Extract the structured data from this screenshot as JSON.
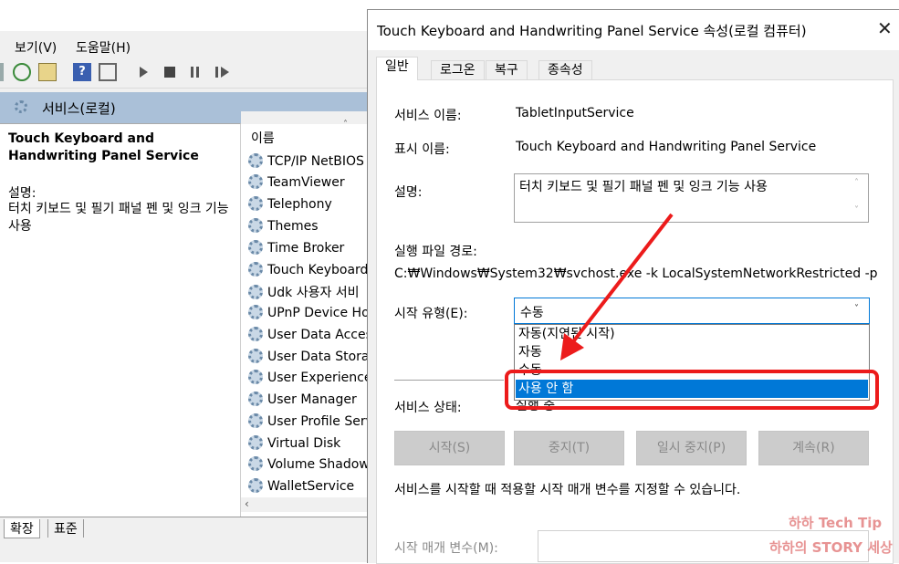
{
  "bg_window": {
    "menu": [
      "보기(V)",
      "도움말(H)"
    ],
    "panel_title": "서비스(로컬)",
    "selected_service_title": "Touch Keyboard and Handwriting Panel Service",
    "desc_label": "설명:",
    "desc_text": "터치 키보드 및 필기 패널 펜 및 잉크 기능 사용",
    "column_header": "이름",
    "services": [
      "TCP/IP NetBIOS",
      "TeamViewer",
      "Telephony",
      "Themes",
      "Time Broker",
      "Touch Keyboard",
      "Udk 사용자 서비",
      "UPnP Device Ho",
      "User Data Access",
      "User Data Storag",
      "User Experience",
      "User Manager",
      "User Profile Serv",
      "Virtual Disk",
      "Volume Shadow",
      "WalletService"
    ],
    "bottom_tabs": [
      "확장",
      "표준"
    ]
  },
  "dialog": {
    "title": "Touch Keyboard and Handwriting Panel Service 속성(로컬 컴퓨터)",
    "tabs": [
      "일반",
      "로그온",
      "복구",
      "종속성"
    ],
    "service_name_label": "서비스 이름:",
    "service_name": "TabletInputService",
    "display_name_label": "표시 이름:",
    "display_name": "Touch Keyboard and Handwriting Panel Service",
    "description_label": "설명:",
    "description": "터치 키보드 및 필기 패널 펜 및 잉크 기능 사용",
    "exe_path_label": "실행 파일 경로:",
    "exe_path": "C:₩Windows₩System32₩svchost.exe -k LocalSystemNetworkRestricted -p",
    "startup_type_label": "시작 유형(E):",
    "startup_type_value": "수동",
    "startup_options": [
      "자동(지연된 시작)",
      "자동",
      "수동",
      "사용 안 함"
    ],
    "service_status_label": "서비스 상태:",
    "service_status": "실행 중",
    "buttons": [
      "시작(S)",
      "중지(T)",
      "일시 중지(P)",
      "계속(R)"
    ],
    "start_params_note": "서비스를 시작할 때 적용할 시작 매개 변수를 지정할 수 있습니다.",
    "start_params_label": "시작 매개 변수(M):"
  },
  "watermark": [
    "하하 Tech Tip",
    "하하의 STORY 세상"
  ],
  "colors": {
    "accent": "#0078d7",
    "highlight": "#0078d7",
    "annotation": "#ec1b1b",
    "panel_header": "#aac0d8"
  }
}
